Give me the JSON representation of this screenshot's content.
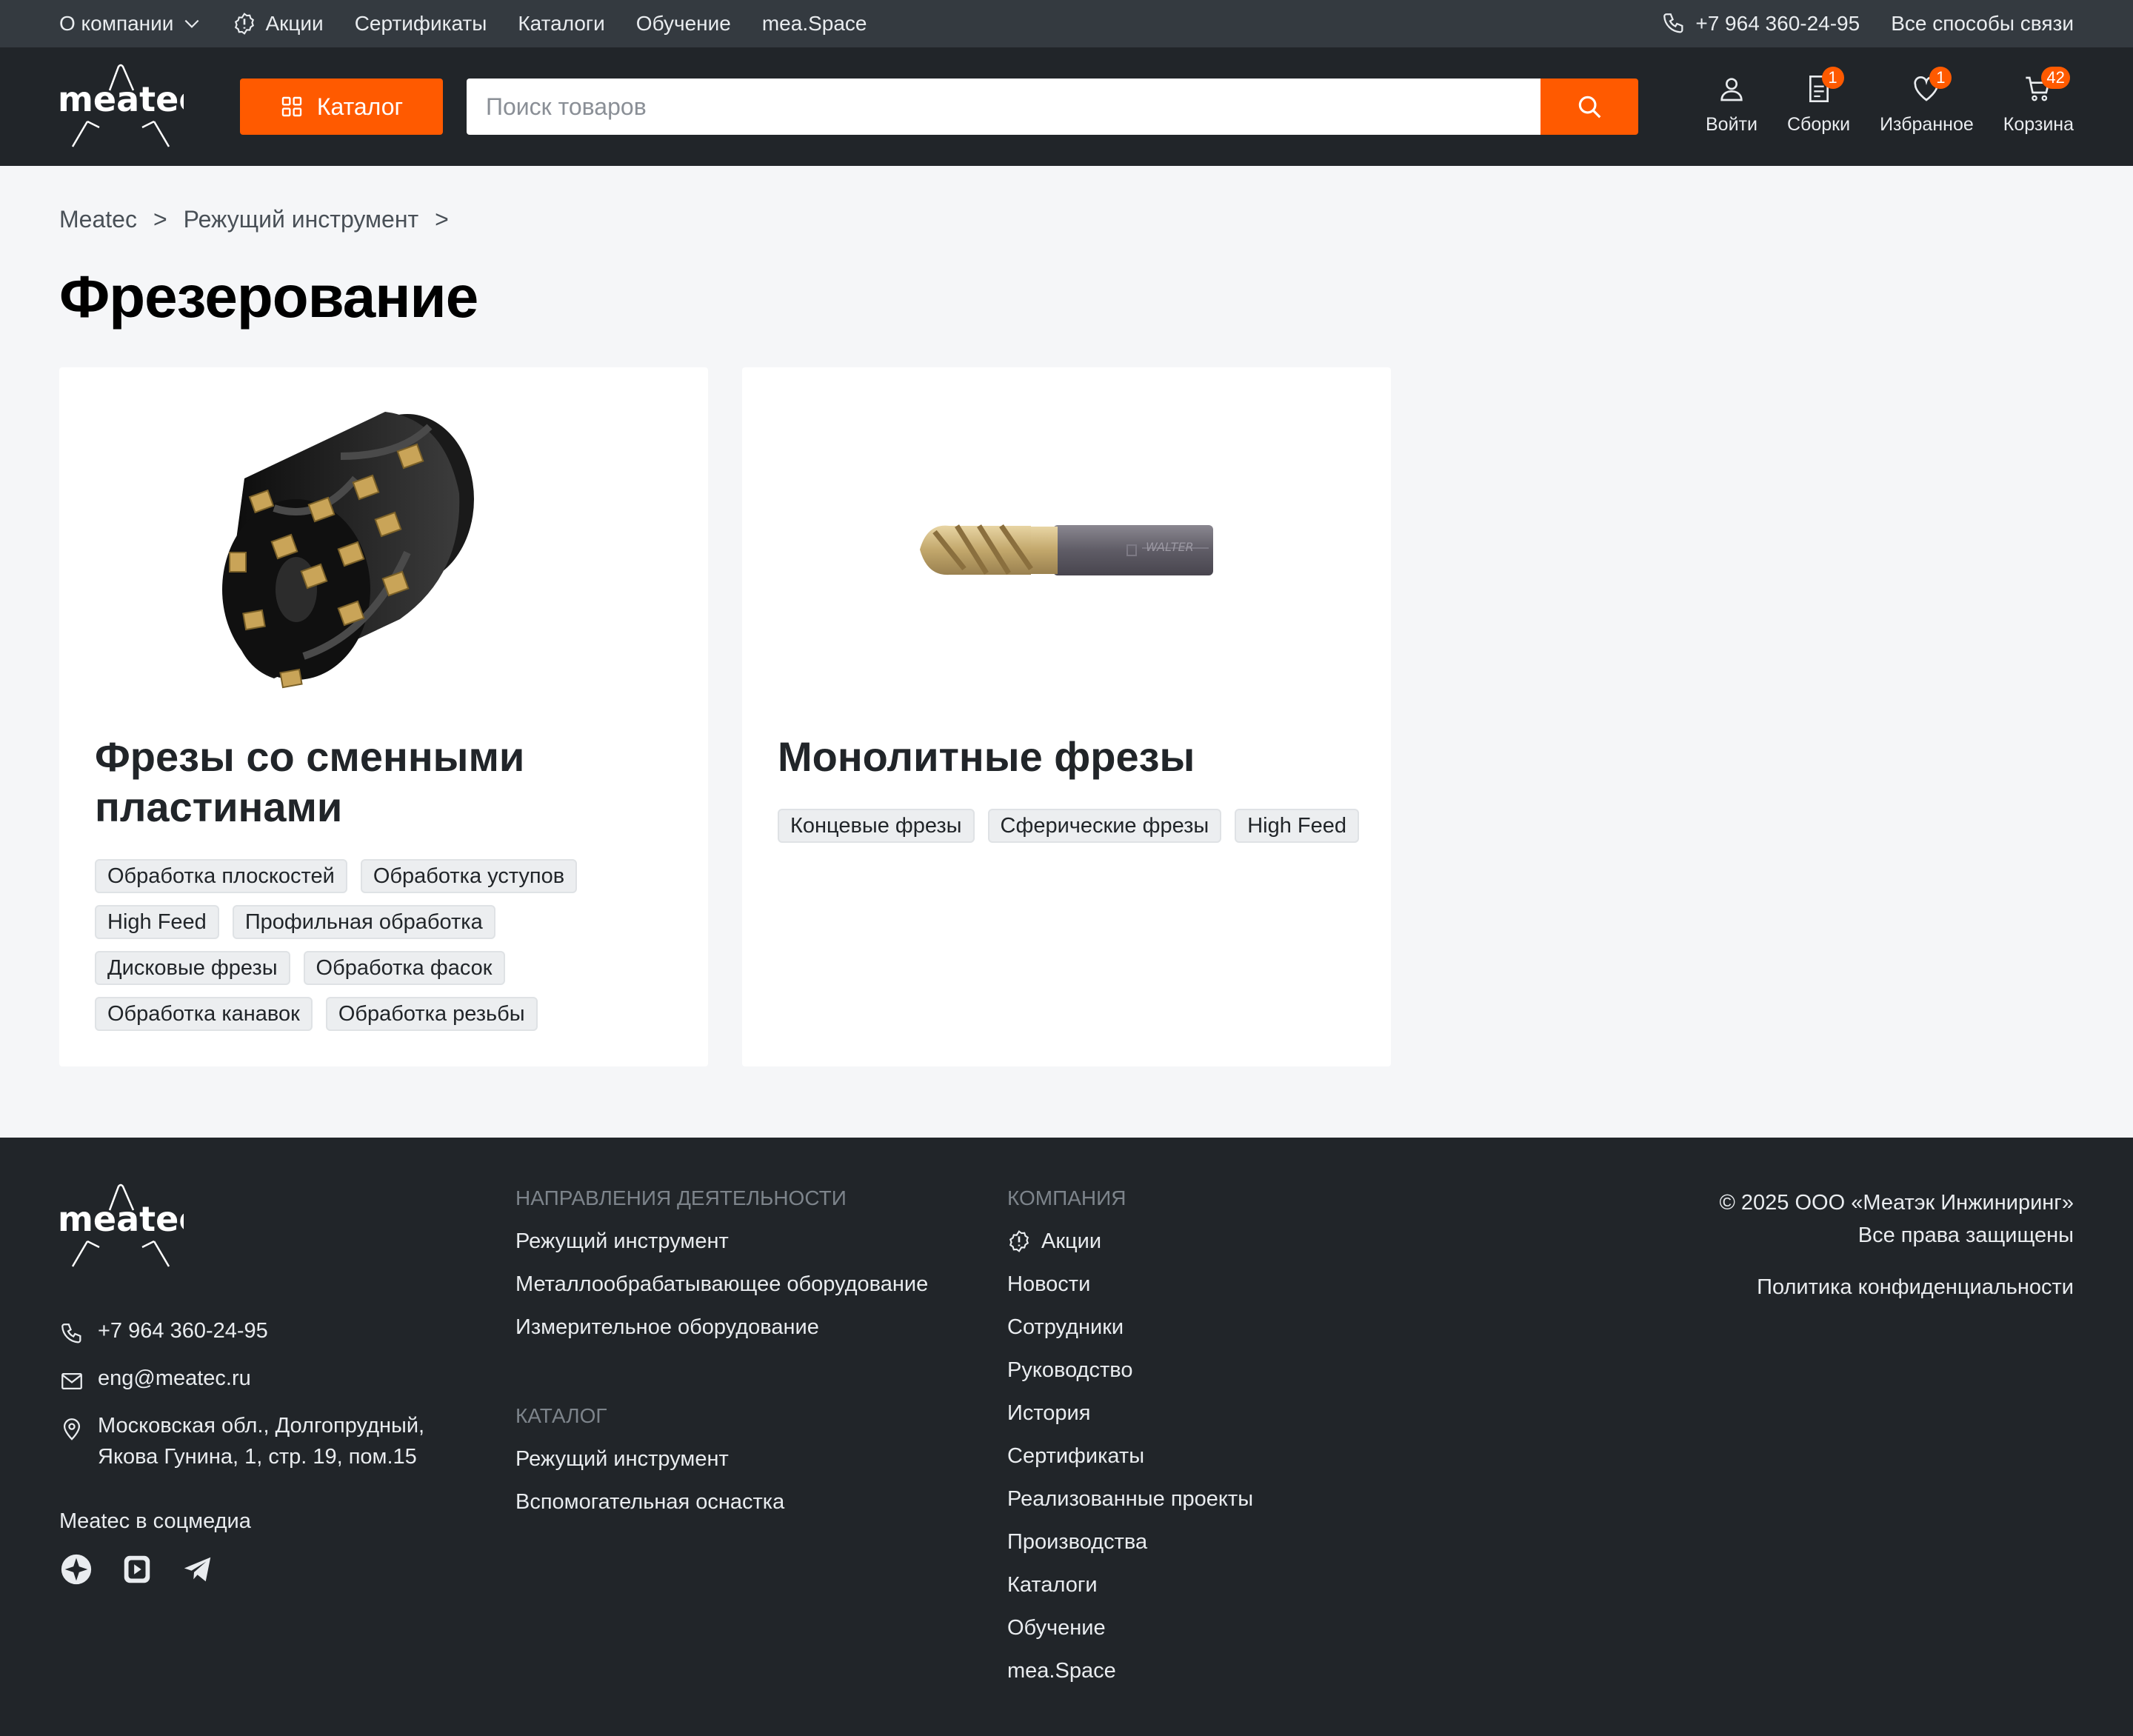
{
  "topbar": {
    "links": [
      "О компании",
      "Акции",
      "Сертификаты",
      "Каталоги",
      "Обучение",
      "mea.Space"
    ],
    "phone": "+7 964 360-24-95",
    "contacts": "Все способы связи"
  },
  "header": {
    "logo": "meatec",
    "catalog_label": "Каталог",
    "search_placeholder": "Поиск товаров",
    "actions": [
      {
        "label": "Войти",
        "icon": "user-icon",
        "badge": ""
      },
      {
        "label": "Сборки",
        "icon": "document-icon",
        "badge": "1"
      },
      {
        "label": "Избранное",
        "icon": "heart-icon",
        "badge": "1"
      },
      {
        "label": "Корзина",
        "icon": "cart-icon",
        "badge": "42"
      }
    ]
  },
  "breadcrumb": [
    "Meatec",
    ">",
    "Режущий инструмент",
    ">"
  ],
  "page_title": "Фрезерование",
  "cards": [
    {
      "title": "Фрезы со сменными пластинами",
      "tags": [
        "Обработка плоскостей",
        "Обработка уступов",
        "High Feed",
        "Профильная обработка",
        "Дисковые фрезы",
        "Обработка фасок",
        "Обработка канавок",
        "Обработка резьбы"
      ]
    },
    {
      "title": "Монолитные фрезы",
      "tags": [
        "Концевые фрезы",
        "Сферические фрезы",
        "High Feed"
      ],
      "image_text": "WALTER"
    }
  ],
  "footer": {
    "logo": "meatec",
    "phone": "+7 964 360-24-95",
    "email": "eng@meatec.ru",
    "address_line1": "Московская обл., Долгопрудный,",
    "address_line2": "Якова Гунина, 1, стр. 19, пом.15",
    "social_title": "Meatec в соцмедиа",
    "directions": {
      "title": "Направления деятельности",
      "links": [
        "Режущий инструмент",
        "Металлообрабатывающее оборудование",
        "Измерительное оборудование"
      ]
    },
    "catalog": {
      "title": "Каталог",
      "links": [
        "Режущий инструмент",
        "Вспомогательная оснастка"
      ]
    },
    "company": {
      "title": "Компания",
      "links": [
        "Акции",
        "Новости",
        "Сотрудники",
        "Руководство",
        "История",
        "Сертификаты",
        "Реализованные проекты",
        "Производства",
        "Каталоги",
        "Обучение",
        "mea.Space"
      ]
    },
    "copyright": "© 2025 ООО «Меатэк Инжиниринг»",
    "rights": "Все права защищены",
    "policy": "Политика конфиденциальности"
  },
  "colors": {
    "accent": "#ff5a00",
    "dark": "#212529",
    "topbar": "#343a40",
    "bg": "#f5f6f8"
  }
}
